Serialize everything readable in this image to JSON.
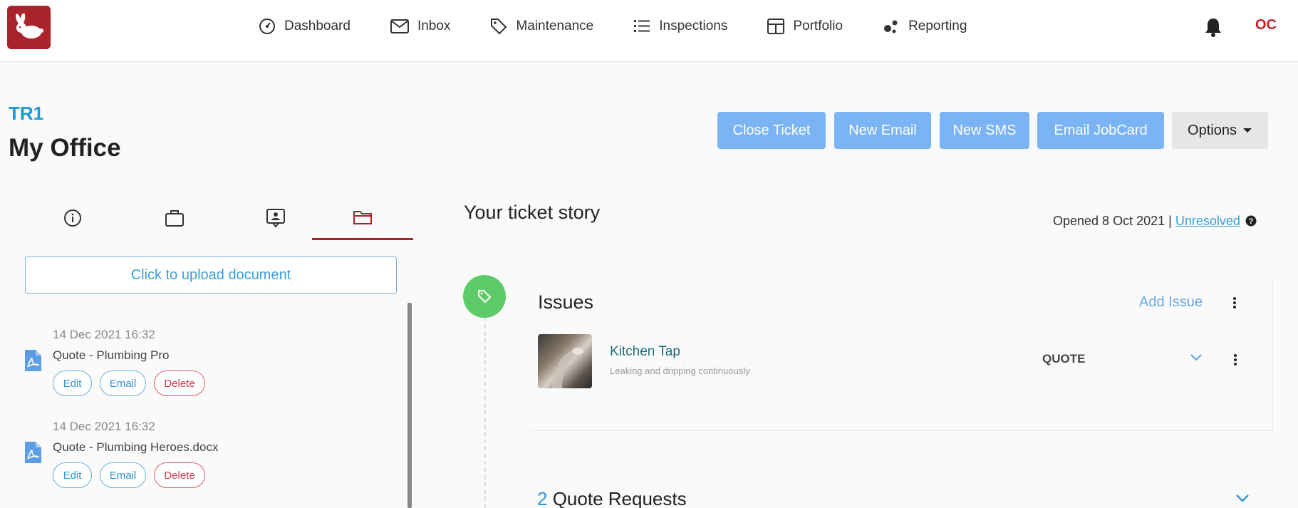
{
  "nav": {
    "items": [
      {
        "label": "Dashboard",
        "icon": "gauge-icon"
      },
      {
        "label": "Inbox",
        "icon": "envelope-icon"
      },
      {
        "label": "Maintenance",
        "icon": "tag-icon"
      },
      {
        "label": "Inspections",
        "icon": "list-icon"
      },
      {
        "label": "Portfolio",
        "icon": "grid-icon"
      },
      {
        "label": "Reporting",
        "icon": "dots-icon"
      }
    ],
    "user_initials": "OC"
  },
  "header": {
    "ticket_id": "TR1",
    "title": "My Office",
    "buttons": {
      "close_ticket": "Close Ticket",
      "new_email": "New Email",
      "new_sms": "New SMS",
      "email_jobcard": "Email JobCard",
      "options": "Options"
    }
  },
  "documents": {
    "upload_label": "Click to upload document",
    "items": [
      {
        "date": "14 Dec 2021 16:32",
        "name": "Quote - Plumbing Pro",
        "edit": "Edit",
        "email": "Email",
        "delete": "Delete"
      },
      {
        "date": "14 Dec 2021 16:32",
        "name": "Quote - Plumbing Heroes.docx",
        "edit": "Edit",
        "email": "Email",
        "delete": "Delete"
      }
    ]
  },
  "story": {
    "title": "Your ticket story",
    "opened": "Opened 8 Oct 2021",
    "separator": "|",
    "status": "Unresolved",
    "issues": {
      "title": "Issues",
      "add_label": "Add Issue",
      "items": [
        {
          "name": "Kitchen Tap",
          "description": "Leaking and dripping continuously",
          "status": "QUOTE"
        }
      ]
    },
    "quote_requests": {
      "count": "2",
      "label": "Quote Requests"
    }
  },
  "colors": {
    "brand": "#a8232a",
    "primary_button": "#7ab4f5",
    "link": "#3aa0d8",
    "success": "#5ccb68"
  }
}
